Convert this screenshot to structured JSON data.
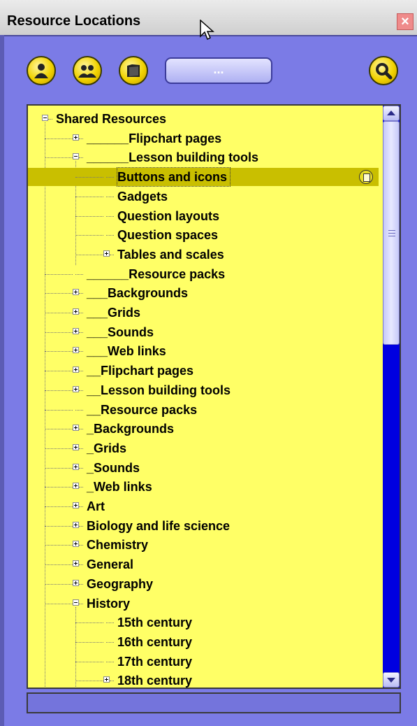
{
  "window": {
    "title": "Resource Locations",
    "close_label": "×"
  },
  "toolbar": {
    "buttons": [
      {
        "icon": "user-icon"
      },
      {
        "icon": "group-icon"
      },
      {
        "icon": "folder-icon"
      }
    ],
    "browse_label": "...",
    "search_icon": "search-icon"
  },
  "tree": {
    "items": [
      {
        "label": "Shared Resources",
        "state": "expanded"
      },
      {
        "label": "______Flipchart pages",
        "state": "collapsed"
      },
      {
        "label": "______Lesson building tools",
        "state": "expanded"
      },
      {
        "label": "Buttons and icons",
        "state": "leaf",
        "selected": true
      },
      {
        "label": "Gadgets",
        "state": "leaf"
      },
      {
        "label": "Question layouts",
        "state": "leaf"
      },
      {
        "label": "Question spaces",
        "state": "leaf"
      },
      {
        "label": "Tables and scales",
        "state": "collapsed"
      },
      {
        "label": "______Resource packs",
        "state": "leaf"
      },
      {
        "label": "___Backgrounds",
        "state": "collapsed"
      },
      {
        "label": "___Grids",
        "state": "collapsed"
      },
      {
        "label": "___Sounds",
        "state": "collapsed"
      },
      {
        "label": "___Web links",
        "state": "collapsed"
      },
      {
        "label": "__Flipchart pages",
        "state": "collapsed"
      },
      {
        "label": "__Lesson building tools",
        "state": "collapsed"
      },
      {
        "label": "__Resource packs",
        "state": "leaf"
      },
      {
        "label": "_Backgrounds",
        "state": "collapsed"
      },
      {
        "label": "_Grids",
        "state": "collapsed"
      },
      {
        "label": "_Sounds",
        "state": "collapsed"
      },
      {
        "label": "_Web links",
        "state": "collapsed"
      },
      {
        "label": "Art",
        "state": "collapsed"
      },
      {
        "label": "Biology and life science",
        "state": "collapsed"
      },
      {
        "label": "Chemistry",
        "state": "collapsed"
      },
      {
        "label": "General",
        "state": "collapsed"
      },
      {
        "label": "Geography",
        "state": "collapsed"
      },
      {
        "label": "History",
        "state": "expanded"
      },
      {
        "label": "15th century",
        "state": "leaf"
      },
      {
        "label": "16th century",
        "state": "leaf"
      },
      {
        "label": "17th century",
        "state": "leaf"
      },
      {
        "label": "18th century",
        "state": "collapsed"
      }
    ]
  },
  "colors": {
    "panel_bg": "#ffff66",
    "frame_bg": "#7b7be6",
    "selection": "#c9bf00",
    "scroll_track": "#0000e0"
  }
}
